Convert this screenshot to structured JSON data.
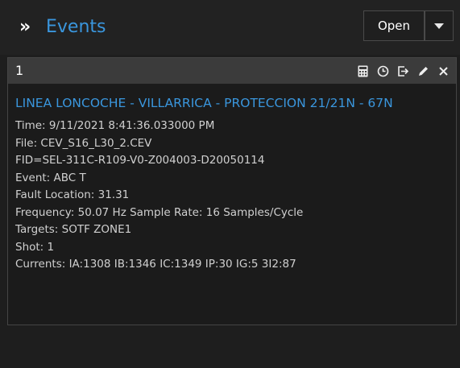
{
  "header": {
    "collapse_glyph": "»",
    "title": "Events",
    "open_label": "Open",
    "icons": [
      "double-chevron-icon",
      "chevron-down-icon"
    ]
  },
  "panel": {
    "number": "1",
    "tool_icons": [
      "calculator-icon",
      "clock-icon",
      "export-icon",
      "pencil-icon",
      "close-icon"
    ],
    "event_title": "LINEA LONCOCHE - VILLARRICA - PROTECCION 21/21N - 67N",
    "lines": {
      "time": "Time:  9/11/2021 8:41:36.033000 PM",
      "file": "File: CEV_S16_L30_2.CEV",
      "fid": "FID=SEL-311C-R109-V0-Z004003-D20050114",
      "event": "Event: ABC T",
      "fault_location": "Fault Location: 31.31",
      "frequency": "Frequency: 50.07 Hz   Sample Rate: 16 Samples/Cycle",
      "targets": "Targets: SOTF ZONE1",
      "shot": "Shot: 1",
      "currents": "Currents: IA:1308 IB:1346 IC:1349 IP:30 IG:5 3I2:87"
    }
  },
  "colors": {
    "accent": "#3a96dd",
    "background": "#1e1e1e",
    "panel_bar": "#3b3b3b",
    "text": "#d0d0d0"
  }
}
